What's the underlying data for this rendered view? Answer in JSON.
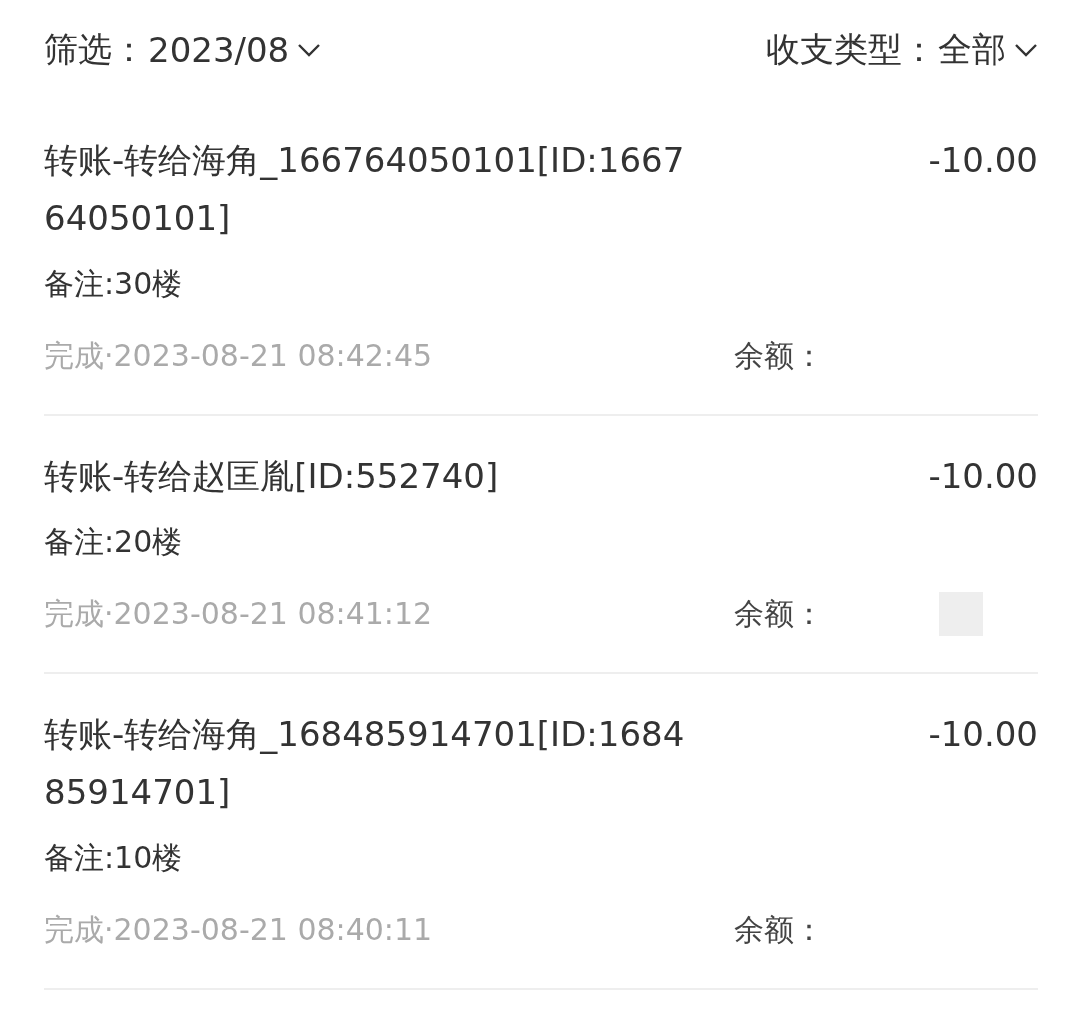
{
  "filter": {
    "label": "筛选：",
    "value": "2023/08"
  },
  "type_filter": {
    "label": "收支类型：",
    "value": "全部"
  },
  "records": [
    {
      "title_lines": [
        "转账-转给海角_166764050101[ID:1667",
        "64050101]"
      ],
      "amount": "-10.00",
      "note": "备注:30楼",
      "status": "完成·2023-08-21 08:42:45",
      "balance_label": "余额：",
      "redacted": false
    },
    {
      "title_lines": [
        "转账-转给赵匡胤[ID:552740]"
      ],
      "amount": "-10.00",
      "note": "备注:20楼",
      "status": "完成·2023-08-21 08:41:12",
      "balance_label": "余额：",
      "redacted": true
    },
    {
      "title_lines": [
        "转账-转给海角_168485914701[ID:1684",
        "85914701]"
      ],
      "amount": "-10.00",
      "note": "备注:10楼",
      "status": "完成·2023-08-21 08:40:11",
      "balance_label": "余额：",
      "redacted": false
    }
  ]
}
